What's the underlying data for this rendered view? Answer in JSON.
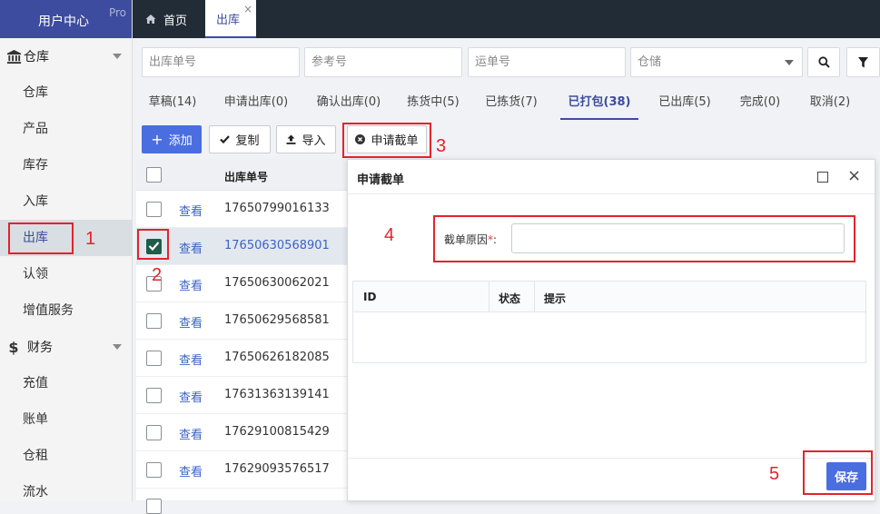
{
  "sidebar": {
    "brand_title": "用户中心",
    "brand_tag": "Pro",
    "warehouse_group": "仓库",
    "finance_group": "财务",
    "items": [
      {
        "label": "仓库"
      },
      {
        "label": "产品"
      },
      {
        "label": "库存"
      },
      {
        "label": "入库"
      },
      {
        "label": "出库"
      },
      {
        "label": "认领"
      },
      {
        "label": "增值服务"
      },
      {
        "label": "充值"
      },
      {
        "label": "账单"
      },
      {
        "label": "仓租"
      },
      {
        "label": "流水"
      }
    ]
  },
  "tabs": {
    "home": "首页",
    "current": "出库",
    "close": "×"
  },
  "filters": {
    "order_no": "出库单号",
    "ref_no": "参考号",
    "waybill": "运单号",
    "warehouse": "仓储"
  },
  "status_tabs": [
    "草稿(14)",
    "申请出库(0)",
    "确认出库(0)",
    "拣货中(5)",
    "已拣货(7)",
    "已打包(38)",
    "已出库(5)",
    "完成(0)",
    "取消(2)"
  ],
  "actions": {
    "add": "添加",
    "copy": "复制",
    "import": "导入",
    "intercept": "申请截单"
  },
  "table": {
    "col_order_no": "出库单号",
    "view_label": "查看",
    "rows": [
      {
        "order_no": "17650799016133",
        "checked": false
      },
      {
        "order_no": "17650630568901",
        "checked": true
      },
      {
        "order_no": "17650630062021",
        "checked": false
      },
      {
        "order_no": "17650629568581",
        "checked": false
      },
      {
        "order_no": "17650626182085",
        "checked": false
      },
      {
        "order_no": "17631363139141",
        "checked": false
      },
      {
        "order_no": "17629100815429",
        "checked": false
      },
      {
        "order_no": "17629093576517",
        "checked": false
      }
    ]
  },
  "dialog": {
    "title": "申请截单",
    "reason_label": "截单原因",
    "required_mark": "*",
    "colon": ":",
    "col_id": "ID",
    "col_status": "状态",
    "col_tip": "提示",
    "save": "保存",
    "close": "×"
  },
  "annotations": [
    "1",
    "2",
    "3",
    "4",
    "5"
  ],
  "colors": {
    "accent": "#3d4c9f",
    "primary_button": "#4a6ee0",
    "annotation": "#e3232c",
    "topbar": "#222c36"
  }
}
